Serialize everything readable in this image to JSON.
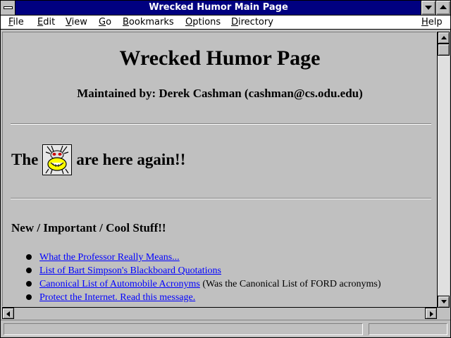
{
  "window": {
    "title": "Wrecked Humor Main Page"
  },
  "menubar": {
    "items": [
      "File",
      "Edit",
      "View",
      "Go",
      "Bookmarks",
      "Options",
      "Directory",
      "Help"
    ]
  },
  "page": {
    "heading": "Wrecked Humor Page",
    "maintainer": "Maintained by: Derek Cashman (cashman@cs.odu.edu)",
    "the_prefix": "The",
    "the_suffix": "are here again!!",
    "bug_icon": "cartoon-bug-icon",
    "section_heading": "New / Important / Cool Stuff!!",
    "list": [
      {
        "link": "What the Professor Really Means...",
        "note": ""
      },
      {
        "link": "List of Bart Simpson's Blackboard Quotations",
        "note": ""
      },
      {
        "link": "Canonical List of Automobile Acronyms",
        "note": "(Was the Canonical List of FORD acronyms)"
      },
      {
        "link": "Protect the Internet. Read this message.",
        "note": ""
      }
    ]
  },
  "colors": {
    "titlebar": "#000080",
    "background": "#c0c0c0",
    "link": "#0000ff"
  }
}
